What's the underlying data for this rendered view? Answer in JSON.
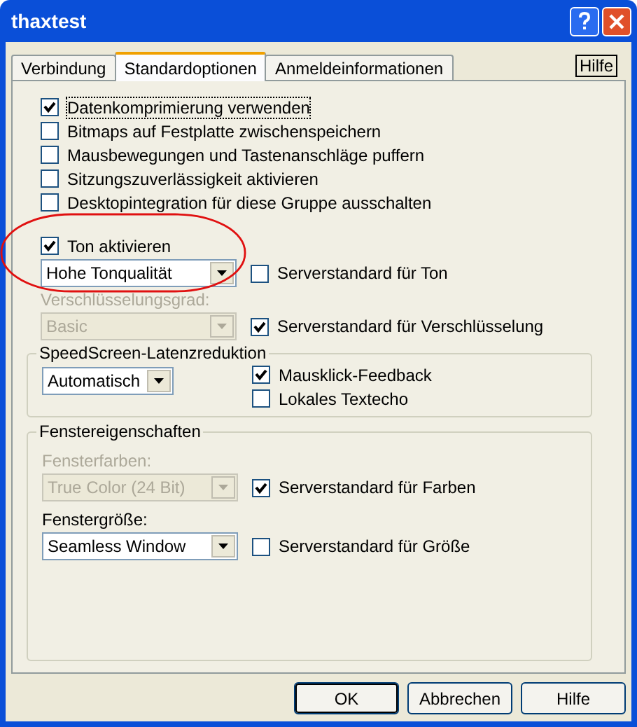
{
  "window": {
    "title": "thaxtest"
  },
  "tabs": [
    {
      "label": "Verbindung",
      "selected": false
    },
    {
      "label": "Standardoptionen",
      "selected": true
    },
    {
      "label": "Anmeldeinformationen",
      "selected": false
    }
  ],
  "help_link": "Hilfe",
  "options": [
    {
      "label": "Datenkomprimierung verwenden",
      "checked": true,
      "focused": true
    },
    {
      "label": "Bitmaps auf Festplatte zwischenspeichern",
      "checked": false,
      "focused": false
    },
    {
      "label": "Mausbewegungen und Tastenanschläge puffern",
      "checked": false,
      "focused": false
    },
    {
      "label": "Sitzungszuverlässigkeit aktivieren",
      "checked": false,
      "focused": false
    },
    {
      "label": "Desktopintegration für diese Gruppe ausschalten",
      "checked": false,
      "focused": false
    }
  ],
  "sound": {
    "checkbox": {
      "label": "Ton aktivieren",
      "checked": true
    },
    "dropdown": {
      "value": "Hohe Tonqualität",
      "disabled": false
    },
    "server_default": {
      "label": "Serverstandard für Ton",
      "checked": false
    }
  },
  "encryption": {
    "label": "Verschlüsselungsgrad:",
    "disabled": true,
    "dropdown": {
      "value": "Basic",
      "disabled": true
    },
    "server_default": {
      "label": "Serverstandard für Verschlüsselung",
      "checked": true
    }
  },
  "latency": {
    "title": "SpeedScreen-Latenzreduktion",
    "dropdown": {
      "value": "Automatisch",
      "disabled": false
    },
    "checkboxes": [
      {
        "label": "Mausklick-Feedback",
        "checked": true
      },
      {
        "label": "Lokales Textecho",
        "checked": false
      }
    ]
  },
  "window_properties": {
    "title": "Fenstereigenschaften",
    "fields": [
      {
        "label": "Fensterfarben:",
        "disabled": true,
        "dropdown": {
          "value": "True Color (24 Bit)",
          "disabled": true
        },
        "server_default": {
          "label": "Serverstandard für Farben",
          "checked": true
        }
      },
      {
        "label": "Fenstergröße:",
        "disabled": false,
        "dropdown": {
          "value": "Seamless Window",
          "disabled": false
        },
        "server_default": {
          "label": "Serverstandard für Größe",
          "checked": false
        }
      }
    ]
  },
  "buttons": [
    {
      "label": "OK",
      "default": true
    },
    {
      "label": "Abbrechen",
      "default": false
    },
    {
      "label": "Hilfe",
      "default": false
    }
  ]
}
